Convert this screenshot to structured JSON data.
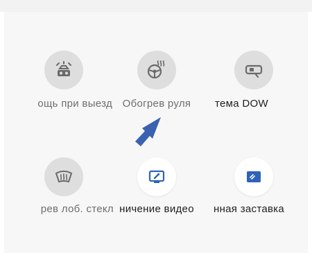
{
  "tiles": [
    {
      "label": "ощь при выезд",
      "icon": "car-exit-assist-icon",
      "state": "off"
    },
    {
      "label": "Обогрев руля",
      "icon": "steering-wheel-heat-icon",
      "state": "off"
    },
    {
      "label": "тема DOW",
      "icon": "door-open-warning-icon",
      "state": "off"
    },
    {
      "label": "рев лоб. стекл",
      "icon": "windshield-defrost-icon",
      "state": "off"
    },
    {
      "label": "ничение видео",
      "icon": "video-restriction-icon",
      "state": "on"
    },
    {
      "label": "нная заставка",
      "icon": "screensaver-icon",
      "state": "on"
    }
  ],
  "colors": {
    "icon_off_bg": "#dedede",
    "icon_on_bg": "#ffffff",
    "icon_glyph": "#6a6a6a",
    "accent": "#2f63b8",
    "pointer_arrow": "#3a62b0"
  }
}
